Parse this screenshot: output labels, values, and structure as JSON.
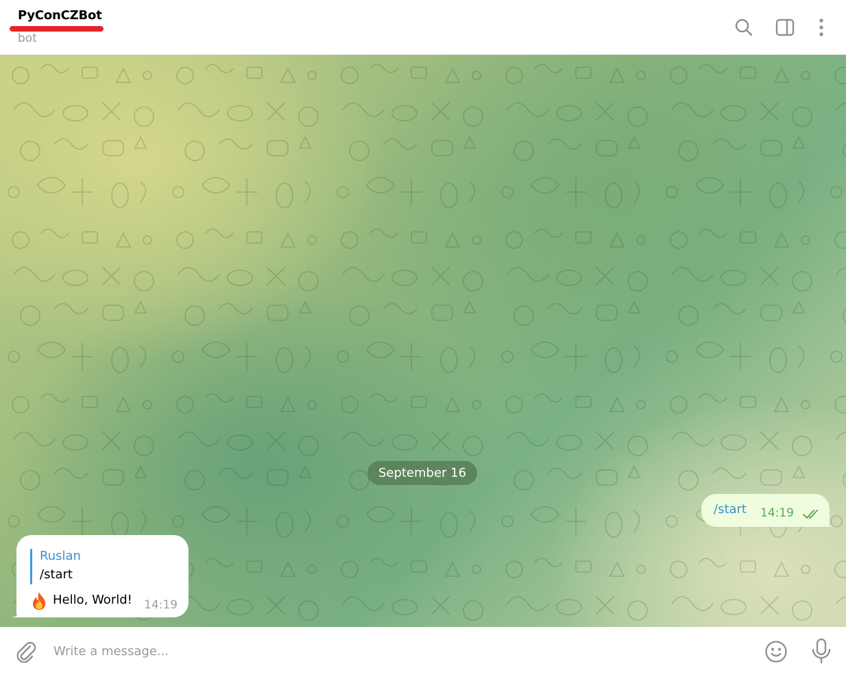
{
  "header": {
    "title": "PyConCZBot",
    "status": "bot",
    "icons": [
      "search-icon",
      "sidebar-toggle-icon",
      "more-vertical-icon"
    ]
  },
  "chat": {
    "date_separator": "September 16",
    "messages": [
      {
        "direction": "outgoing",
        "text": "/start",
        "time": "14:19",
        "status_icon": "double-check-icon"
      },
      {
        "direction": "incoming",
        "reply_to": {
          "sender": "Ruslan",
          "text": "/start"
        },
        "emoji": "🔥",
        "text": "Hello, World!",
        "time": "14:19"
      }
    ]
  },
  "composer": {
    "placeholder": "Write a message...",
    "icons": [
      "paperclip-icon",
      "emoji-icon",
      "microphone-icon"
    ]
  },
  "colors": {
    "accent": "#3a8fd0",
    "outgoing_bubble": "#effdde",
    "read_check": "#5aaa5a",
    "title_underline": "#e3242b",
    "date_pill": "#567852"
  }
}
